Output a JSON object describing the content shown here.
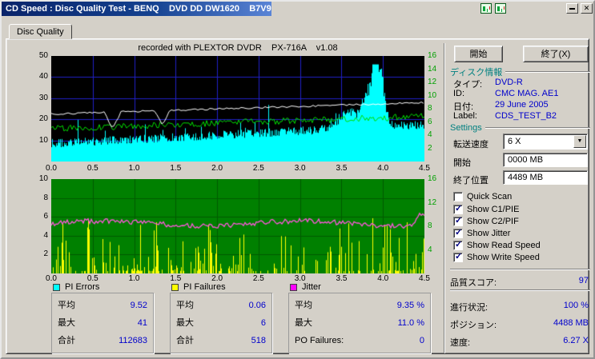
{
  "window": {
    "title": "CD Speed : Disc Quality Test - BENQ    DVD DD DW1620    B7V9"
  },
  "icons": {
    "close": "✕",
    "check": "✓",
    "dropdown": "▼"
  },
  "tab": {
    "label": "Disc Quality"
  },
  "chart_header": "recorded with PLEXTOR DVDR    PX-716A    v1.08",
  "actions": {
    "start": "開始",
    "exit": "終了(X)"
  },
  "disc_info": {
    "header": "ディスク情報",
    "type_label": "タイプ:",
    "type_value": "DVD-R",
    "id_label": "ID:",
    "id_value": "CMC MAG. AE1",
    "date_label": "日付:",
    "date_value": "29 June 2005",
    "label_label": "Label:",
    "label_value": "CDS_TEST_B2"
  },
  "settings": {
    "header": "Settings",
    "speed_label": "転送速度",
    "speed_value": "6 X",
    "start_label": "開始",
    "start_value": "0000 MB",
    "end_label": "終了位置",
    "end_value": "4489 MB",
    "checkboxes": [
      {
        "label": "Quick Scan",
        "checked": false
      },
      {
        "label": "Show C1/PIE",
        "checked": true
      },
      {
        "label": "Show C2/PIF",
        "checked": true
      },
      {
        "label": "Show Jitter",
        "checked": true
      },
      {
        "label": "Show Read Speed",
        "checked": true
      },
      {
        "label": "Show Write Speed",
        "checked": true
      }
    ]
  },
  "quality": {
    "label": "品質スコア:",
    "value": "97"
  },
  "status": {
    "progress_label": "進行状況:",
    "progress_value": "100 %",
    "position_label": "ポジション:",
    "position_value": "4488 MB",
    "speed_label": "速度:",
    "speed_value": "6.27 X"
  },
  "legend": {
    "pi_errors": {
      "title": "PI Errors",
      "color": "#00ffff",
      "avg_label": "平均",
      "avg": "9.52",
      "max_label": "最大",
      "max": "41",
      "total_label": "合計",
      "total": "112683"
    },
    "pi_failures": {
      "title": "PI Failures",
      "color": "#ffff00",
      "avg_label": "平均",
      "avg": "0.06",
      "max_label": "最大",
      "max": "6",
      "total_label": "合計",
      "total": "518"
    },
    "jitter": {
      "title": "Jitter",
      "color": "#ff00ff",
      "avg_label": "平均",
      "avg": "9.35 %",
      "max_label": "最大",
      "max": "11.0 %",
      "po_label": "PO Failures:",
      "po": "0"
    }
  },
  "charts": {
    "x_unit": "GB",
    "top": {
      "type": "area+line",
      "left_ticks": [
        "50",
        "40",
        "30",
        "20",
        "10"
      ],
      "right_ticks": [
        "16",
        "14",
        "12",
        "10",
        "8",
        "6",
        "4",
        "2"
      ],
      "x_ticks": [
        "0.0",
        "0.5",
        "1.0",
        "1.5",
        "2.0",
        "2.5",
        "3.0",
        "3.5",
        "4.0",
        "4.5"
      ],
      "bg": "#000000",
      "grid_color": "#2121c8",
      "series": {
        "pi_errors": "#00ffff",
        "write_speed": "#00e000",
        "read_speed": "#ffffff"
      }
    },
    "bottom": {
      "type": "spikes+line",
      "left_ticks": [
        "10",
        "8",
        "6",
        "4",
        "2"
      ],
      "right_ticks": [
        "16",
        "12",
        "8",
        "4"
      ],
      "x_ticks": [
        "0.0",
        "0.5",
        "1.0",
        "1.5",
        "2.0",
        "2.5",
        "3.0",
        "3.5",
        "4.0",
        "4.5"
      ],
      "bg": "#008000",
      "grid_color": "#005a00",
      "series": {
        "pi_failures": "#ffff00",
        "jitter": "#ff55dd"
      }
    }
  }
}
